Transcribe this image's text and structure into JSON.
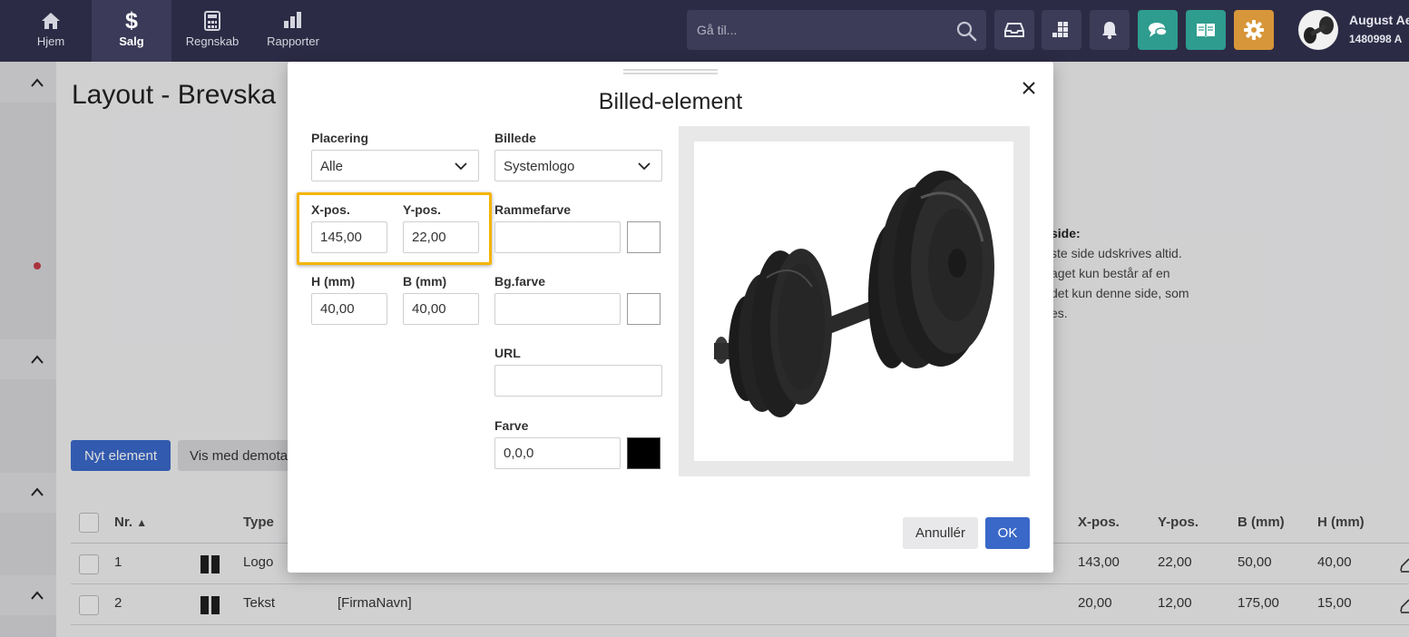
{
  "nav": {
    "items": [
      {
        "label": "Hjem",
        "icon": "home-icon"
      },
      {
        "label": "Salg",
        "icon": "dollar-icon"
      },
      {
        "label": "Regnskab",
        "icon": "calculator-icon"
      },
      {
        "label": "Rapporter",
        "icon": "bar-chart-icon"
      }
    ],
    "active_index": 1,
    "search_placeholder": "Gå til...",
    "user_name": "August Ae",
    "user_id": "1480998 A",
    "colors": {
      "bar": "#2c2b45",
      "teal": "#2e9c8e",
      "orange": "#d8963a"
    }
  },
  "page": {
    "title": "Layout - Brevska",
    "side_note": {
      "heading": "side:",
      "lines": [
        "ste side udskrives altid.",
        "aget kun består af en",
        "det kun denne side, som",
        "es."
      ]
    },
    "new_element_label": "Nyt element",
    "demo_label": "Vis med demota"
  },
  "table": {
    "headers": {
      "nr": "Nr.",
      "type": "Type",
      "xpos": "X-pos.",
      "ypos": "Y-pos.",
      "b": "B (mm)",
      "h": "H (mm)"
    },
    "rows": [
      {
        "nr": "1",
        "type": "Logo",
        "content": "",
        "xpos": "143,00",
        "ypos": "22,00",
        "b": "50,00",
        "h": "40,00"
      },
      {
        "nr": "2",
        "type": "Tekst",
        "content": "[FirmaNavn]",
        "xpos": "20,00",
        "ypos": "12,00",
        "b": "175,00",
        "h": "15,00"
      }
    ]
  },
  "modal": {
    "title": "Billed-element",
    "placering": {
      "label": "Placering",
      "value": "Alle"
    },
    "billede": {
      "label": "Billede",
      "value": "Systemlogo"
    },
    "xpos": {
      "label": "X-pos.",
      "value": "145,00"
    },
    "ypos": {
      "label": "Y-pos.",
      "value": "22,00"
    },
    "h": {
      "label": "H (mm)",
      "value": "40,00"
    },
    "b": {
      "label": "B (mm)",
      "value": "40,00"
    },
    "rammefarve": {
      "label": "Rammefarve",
      "value": "",
      "swatch": "#ffffff"
    },
    "bgfarve": {
      "label": "Bg.farve",
      "value": "",
      "swatch": "#ffffff"
    },
    "url": {
      "label": "URL",
      "value": ""
    },
    "farve": {
      "label": "Farve",
      "value": "0,0,0",
      "swatch": "#000000"
    },
    "cancel_label": "Annullér",
    "ok_label": "OK",
    "highlight_color": "#f4b400"
  }
}
